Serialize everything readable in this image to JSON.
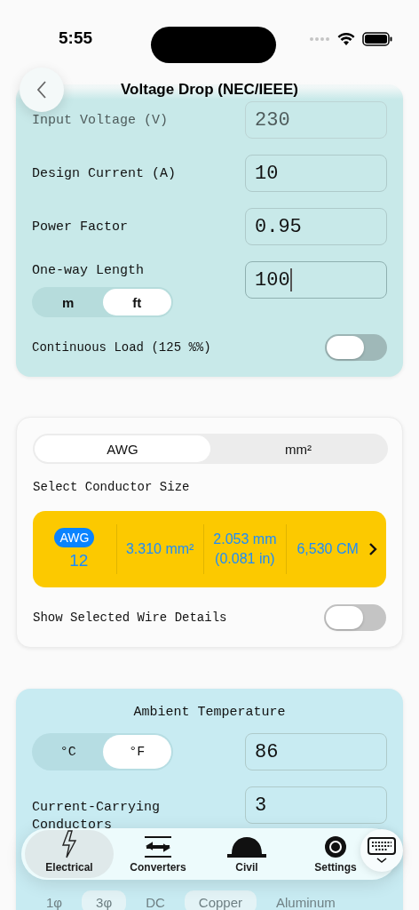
{
  "status_bar": {
    "time": "5:55"
  },
  "header": {
    "title": "Voltage Drop (NEC/IEEE)"
  },
  "inputs_card": {
    "rows": [
      {
        "kind": "field",
        "label": "Input Voltage (V)",
        "value": "230",
        "faded": true,
        "focused": false
      },
      {
        "kind": "field",
        "label": "Design Current (A)",
        "value": "10",
        "faded": false,
        "focused": false
      },
      {
        "kind": "field",
        "label": "Power Factor",
        "value": "0.95",
        "faded": false,
        "focused": false
      },
      {
        "kind": "length",
        "label": "One-way Length",
        "value": "100",
        "faded": false,
        "focused": true,
        "units": [
          {
            "label": "m",
            "selected": false
          },
          {
            "label": "ft",
            "selected": true
          }
        ]
      },
      {
        "kind": "toggle",
        "label": "Continuous Load (125 %%)",
        "on": false
      }
    ]
  },
  "conductor_card": {
    "unit_tabs": [
      {
        "label": "AWG",
        "selected": true
      },
      {
        "label": "mm²",
        "selected": false
      }
    ],
    "prompt": "Select Conductor Size",
    "selector": {
      "badge": "AWG",
      "size": "12",
      "area": "3.310 mm²",
      "diameter": "2.053 mm",
      "diameter_in": "(0.081 in)",
      "circular_mils": "6,530 CM"
    },
    "details_toggle": {
      "label": "Show Selected Wire Details",
      "on": false
    }
  },
  "ambient_card": {
    "title": "Ambient Temperature",
    "units": [
      {
        "label": "°C",
        "selected": false
      },
      {
        "label": "°F",
        "selected": true
      }
    ],
    "value": "86",
    "conductors": {
      "label": "Current-Carrying Conductors",
      "value": "3"
    },
    "phase_options": [
      {
        "label": "1φ",
        "selected": false
      },
      {
        "label": "3φ",
        "selected": true
      },
      {
        "label": "DC",
        "selected": false
      }
    ],
    "material_options": [
      {
        "label": "Copper",
        "selected": true
      },
      {
        "label": "Aluminum",
        "selected": false
      }
    ]
  },
  "tab_bar": {
    "items": [
      {
        "kind": "electrical",
        "label": "Electrical",
        "selected": true
      },
      {
        "kind": "converters",
        "label": "Converters",
        "selected": false
      },
      {
        "kind": "civil",
        "label": "Civil",
        "selected": false
      },
      {
        "kind": "settings",
        "label": "Settings",
        "selected": false
      }
    ]
  }
}
